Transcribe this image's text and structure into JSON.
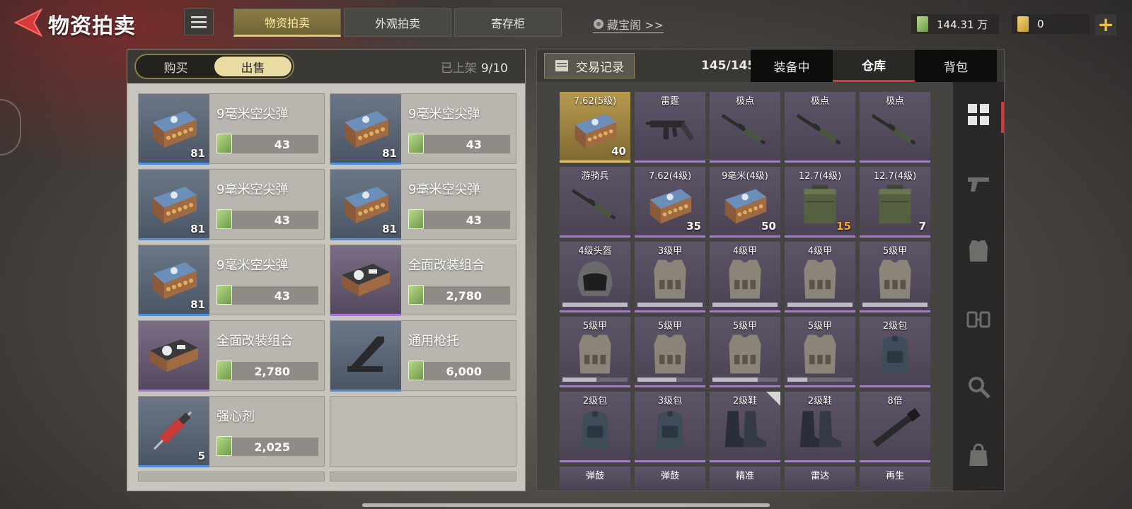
{
  "header": {
    "title": "物资拍卖",
    "tabs": [
      {
        "label": "物资拍卖",
        "active": true
      },
      {
        "label": "外观拍卖",
        "active": false
      },
      {
        "label": "寄存柜",
        "active": false
      }
    ],
    "treasure_link": "藏宝阁 >>",
    "currency_amount": "144.31 万",
    "ticket_amount": "0",
    "plus_symbol": "+"
  },
  "left": {
    "toggle": [
      "购买",
      "出售"
    ],
    "active_toggle": "出售",
    "listed_label": "已上架",
    "listed_value": "9/10",
    "items": [
      {
        "name": "9毫米空尖弹",
        "price": "43",
        "qty": "81",
        "rarity": "blue",
        "icon": "ammo-box-icon"
      },
      {
        "name": "9毫米空尖弹",
        "price": "43",
        "qty": "81",
        "rarity": "blue",
        "icon": "ammo-box-icon"
      },
      {
        "name": "9毫米空尖弹",
        "price": "43",
        "qty": "81",
        "rarity": "blue",
        "icon": "ammo-box-icon"
      },
      {
        "name": "9毫米空尖弹",
        "price": "43",
        "qty": "81",
        "rarity": "blue",
        "icon": "ammo-box-icon"
      },
      {
        "name": "9毫米空尖弹",
        "price": "43",
        "qty": "81",
        "rarity": "blue",
        "icon": "ammo-box-icon"
      },
      {
        "name": "全面改装组合",
        "price": "2,780",
        "qty": "",
        "rarity": "purple",
        "icon": "mod-kit-icon"
      },
      {
        "name": "全面改装组合",
        "price": "2,780",
        "qty": "",
        "rarity": "purple",
        "icon": "mod-kit-icon"
      },
      {
        "name": "通用枪托",
        "price": "6,000",
        "qty": "",
        "rarity": "blue",
        "icon": "stock-icon"
      },
      {
        "name": "强心剂",
        "price": "2,025",
        "qty": "5",
        "rarity": "blue",
        "icon": "syringe-icon"
      }
    ]
  },
  "right": {
    "trade_record": "交易记录",
    "capacity": "145/145",
    "tabs": [
      {
        "label": "装备中",
        "active": false
      },
      {
        "label": "仓库",
        "active": true
      },
      {
        "label": "背包",
        "active": false
      }
    ],
    "inventory": [
      {
        "label": "7.62(5级)",
        "qty": "40",
        "rarity": "gold",
        "icon": "ammo-box-icon"
      },
      {
        "label": "雷霆",
        "qty": "",
        "rarity": "purple",
        "icon": "smg-icon"
      },
      {
        "label": "极点",
        "qty": "",
        "rarity": "purple",
        "icon": "rifle-icon"
      },
      {
        "label": "极点",
        "qty": "",
        "rarity": "purple",
        "icon": "rifle-icon"
      },
      {
        "label": "极点",
        "qty": "",
        "rarity": "purple",
        "icon": "rifle-icon"
      },
      {
        "label": "游骑兵",
        "qty": "",
        "rarity": "purple",
        "icon": "rifle-icon"
      },
      {
        "label": "7.62(4级)",
        "qty": "35",
        "rarity": "purple",
        "icon": "ammo-box-icon"
      },
      {
        "label": "9毫米(4级)",
        "qty": "50",
        "rarity": "purple",
        "icon": "ammo-box-icon"
      },
      {
        "label": "12.7(4级)",
        "qty": "15",
        "rarity": "purple",
        "icon": "ammo-crate-icon",
        "qty_color": "orange"
      },
      {
        "label": "12.7(4级)",
        "qty": "7",
        "rarity": "purple",
        "icon": "ammo-crate-icon"
      },
      {
        "label": "4级头盔",
        "qty": "",
        "rarity": "purple",
        "icon": "helmet-icon",
        "durability": 1.0
      },
      {
        "label": "3级甲",
        "qty": "",
        "rarity": "purple",
        "icon": "vest-icon",
        "durability": 1.0
      },
      {
        "label": "4级甲",
        "qty": "",
        "rarity": "purple",
        "icon": "vest-icon",
        "durability": 1.0
      },
      {
        "label": "4级甲",
        "qty": "",
        "rarity": "purple",
        "icon": "vest-icon",
        "durability": 1.0
      },
      {
        "label": "5级甲",
        "qty": "",
        "rarity": "purple",
        "icon": "vest-icon",
        "durability": 1.0
      },
      {
        "label": "5级甲",
        "qty": "",
        "rarity": "purple",
        "icon": "vest-icon",
        "durability": 0.52
      },
      {
        "label": "5级甲",
        "qty": "",
        "rarity": "purple",
        "icon": "vest-icon",
        "durability": 0.6
      },
      {
        "label": "5级甲",
        "qty": "",
        "rarity": "purple",
        "icon": "vest-icon",
        "durability": 0.7
      },
      {
        "label": "5级甲",
        "qty": "",
        "rarity": "purple",
        "icon": "vest-icon",
        "durability": 0.3
      },
      {
        "label": "2级包",
        "qty": "",
        "rarity": "purple",
        "icon": "backpack-icon"
      },
      {
        "label": "2级包",
        "qty": "",
        "rarity": "purple",
        "icon": "backpack-icon"
      },
      {
        "label": "3级包",
        "qty": "",
        "rarity": "purple",
        "icon": "backpack-icon"
      },
      {
        "label": "2级鞋",
        "qty": "",
        "rarity": "purple",
        "icon": "boots-icon",
        "new": true
      },
      {
        "label": "2级鞋",
        "qty": "",
        "rarity": "purple",
        "icon": "boots-icon"
      },
      {
        "label": "8倍",
        "qty": "",
        "rarity": "purple",
        "icon": "scope-icon"
      }
    ],
    "partial_row": [
      "弹鼓",
      "弹鼓",
      "精准",
      "雷达",
      "再生"
    ],
    "categories": [
      {
        "name": "all-icon",
        "active": true
      },
      {
        "name": "pistol-icon",
        "active": false
      },
      {
        "name": "vest-icon",
        "active": false
      },
      {
        "name": "ammo-icon",
        "active": false
      },
      {
        "name": "gear-wrench-icon",
        "active": false
      },
      {
        "name": "bag-icon",
        "active": false
      }
    ]
  },
  "colors": {
    "accent_gold": "#e2c66a",
    "rarity_blue": "#4a90e0",
    "rarity_purple": "#a874e0",
    "rarity_gold": "#f2c94c",
    "active_red": "#d6373a"
  }
}
